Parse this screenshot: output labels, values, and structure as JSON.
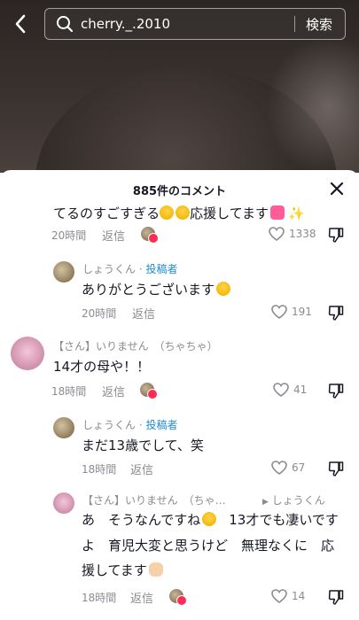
{
  "search": {
    "query": "cherry._.2010",
    "button": "検索"
  },
  "panel": {
    "title": "885件のコメント"
  },
  "comments": [
    {
      "text": "てるのすごすぎる",
      "text_tail": "応援してます",
      "time": "20時間",
      "reply": "返信",
      "likes": "1338"
    },
    {
      "name": "しょうくん",
      "badge": "投稿者",
      "text": "ありがとうございます",
      "time": "20時間",
      "reply": "返信",
      "likes": "191"
    },
    {
      "name": "【さん】いりません　（ちゃちゃ）",
      "text": "14才の母や！！",
      "time": "18時間",
      "reply": "返信",
      "likes": "41"
    },
    {
      "name": "しょうくん",
      "badge": "投稿者",
      "text": "まだ13歳でして、笑",
      "time": "18時間",
      "reply": "返信",
      "likes": "67"
    },
    {
      "name": "【さん】いりません　（ちゃ…",
      "reply_to": "しょうくん",
      "text_l1a": "あ　そうなんですね",
      "text_l1b": "13才でも凄いです",
      "text_l2": "よ　育児大変と思うけど　無理なくに　応",
      "text_l3": "援してます",
      "time": "18時間",
      "reply": "返信",
      "likes": "14"
    }
  ],
  "icons": {
    "back": "chevron-left-icon",
    "search": "search-icon",
    "close": "close-icon",
    "like": "heart-outline-icon",
    "dislike": "thumbs-down-icon"
  },
  "colors": {
    "author": "#1e8bd6",
    "heart": "#fe2c55"
  }
}
